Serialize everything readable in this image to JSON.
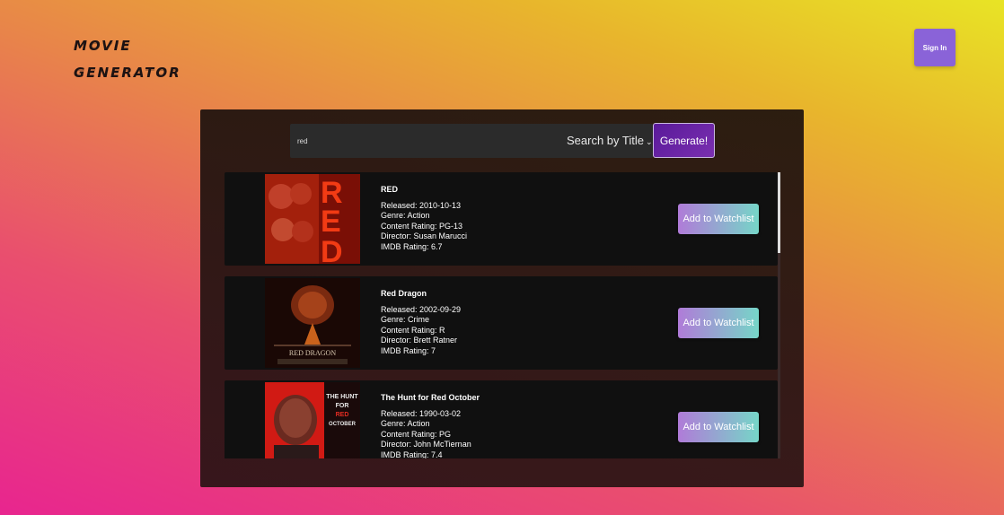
{
  "header": {
    "logo_line1": "MOVIE",
    "logo_line2": "GENERATOR",
    "signin_label": "Sign In"
  },
  "search": {
    "query": "red",
    "mode": "Search by Title",
    "generate_label": "Generate!"
  },
  "results": [
    {
      "title": "RED",
      "released": "Released: 2010-10-13",
      "genre": "Genre: Action",
      "content_rating": "Content Rating: PG-13",
      "director": "Director: Susan Marucci",
      "imdb": "IMDB Rating: 6.7",
      "button": "Add to Watchlist",
      "poster_text": "RED"
    },
    {
      "title": "Red Dragon",
      "released": "Released: 2002-09-29",
      "genre": "Genre: Crime",
      "content_rating": "Content Rating: R",
      "director": "Director: Brett Ratner",
      "imdb": "IMDB Rating: 7",
      "button": "Add to Watchlist",
      "poster_text": "RED DRAGON"
    },
    {
      "title": "The Hunt for Red October",
      "released": "Released: 1990-03-02",
      "genre": "Genre: Action",
      "content_rating": "Content Rating: PG",
      "director": "Director: John McTiernan",
      "imdb": "IMDB Rating: 7.4",
      "button": "Add to Watchlist",
      "poster_text": "THE HUNT FOR RED OCTOBER"
    }
  ]
}
